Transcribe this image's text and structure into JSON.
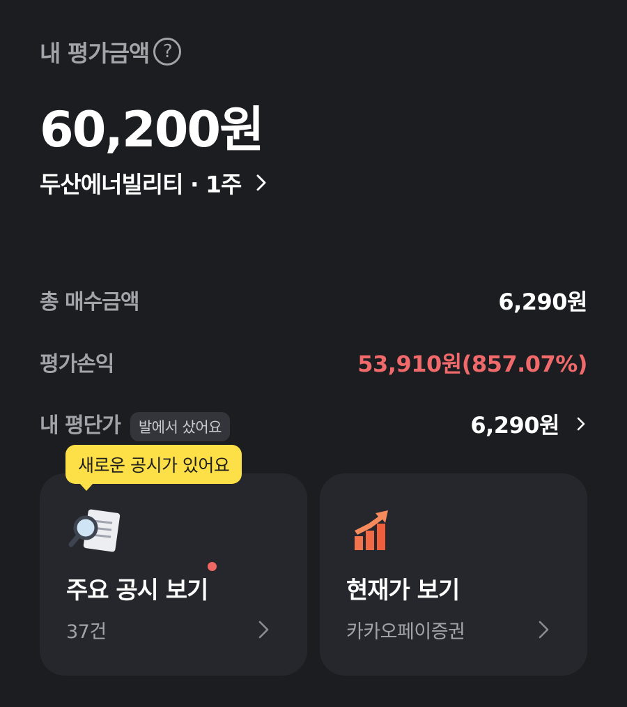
{
  "header": {
    "label": "내 평가금액",
    "help_icon": "help-icon"
  },
  "summary": {
    "total": "60,200원",
    "stock_line": "두산에너빌리티 · 1주"
  },
  "rows": {
    "purchase_label": "총 매수금액",
    "purchase_value": "6,290원",
    "profit_label": "평가손익",
    "profit_value": "53,910원(857.07%)",
    "avg_label": "내 평단가",
    "avg_chip": "발에서 샀어요",
    "avg_value": "6,290원"
  },
  "tooltip": {
    "text": "새로운 공시가 있어요"
  },
  "cards": [
    {
      "title": "주요 공시 보기",
      "sub": "37건",
      "icon": "document-search-icon"
    },
    {
      "title": "현재가 보기",
      "sub": "카카오페이증권",
      "icon": "growth-chart-icon"
    }
  ],
  "colors": {
    "background": "#1c1d21",
    "card": "#26272c",
    "profit": "#f0696b",
    "tooltip": "#fde047",
    "dot": "#f26764"
  }
}
